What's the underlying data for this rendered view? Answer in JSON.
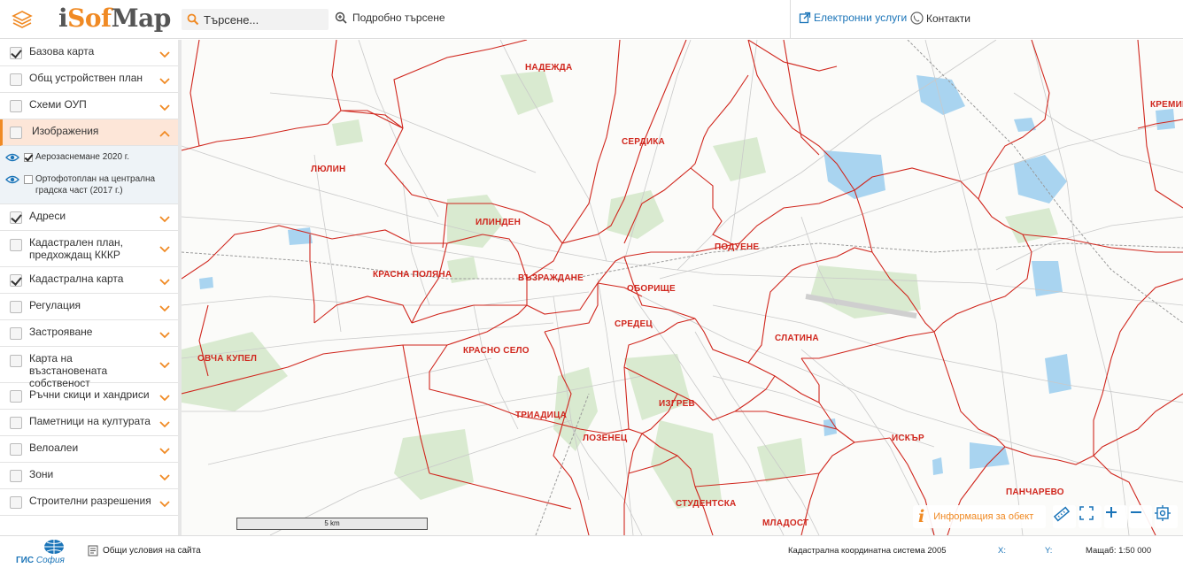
{
  "header": {
    "logo_pre": "i",
    "logo_accent": "Sof",
    "logo_post": "Map",
    "search_placeholder": "Търсене...",
    "advanced_search": "Подробно търсене",
    "eservices": "Електронни услуги",
    "contacts": "Контакти"
  },
  "sidebar": {
    "layers": [
      {
        "label": "Базова карта",
        "checked": true
      },
      {
        "label": "Общ устройствен план",
        "checked": false
      },
      {
        "label": "Схеми ОУП",
        "checked": false
      },
      {
        "label": "Изображения",
        "checked": false,
        "open": true
      },
      {
        "label": "Адреси",
        "checked": true
      },
      {
        "label": "Кадастрален план, предхождащ КККР",
        "checked": false
      },
      {
        "label": "Кадастрална карта",
        "checked": true
      },
      {
        "label": "Регулация",
        "checked": false
      },
      {
        "label": "Застрояване",
        "checked": false
      },
      {
        "label": "Карта на възстановената собственост",
        "checked": false
      },
      {
        "label": "Ръчни скици и хандриси",
        "checked": false
      },
      {
        "label": "Паметници на културата",
        "checked": false
      },
      {
        "label": "Велоалеи",
        "checked": false
      },
      {
        "label": "Зони",
        "checked": false
      },
      {
        "label": "Строителни разрешения",
        "checked": false
      }
    ],
    "sublayers": [
      {
        "label": "Аерозаснемане 2020 г.",
        "checked": true
      },
      {
        "label": "Ортофотоплан на централна градска част (2017 г.)",
        "checked": false
      }
    ]
  },
  "map": {
    "districts": {
      "nadezhda": "НАДЕЖДА",
      "kremikovtsi": "КРЕМИК",
      "serdika": "СЕРДИКА",
      "lyulin": "ЛЮЛИН",
      "ilinden": "ИЛИНДЕН",
      "poduyane": "ПОДУЕНЕ",
      "krasna_polyana": "КРАСНА ПОЛЯНА",
      "vazrazhdane": "ВЪЗРАЖДАНЕ",
      "oborishte": "ОБОРИЩЕ",
      "sredets": "СРЕДЕЦ",
      "slatina": "СЛАТИНА",
      "krasno_selo": "КРАСНО СЕЛО",
      "ovcha_kupel": "ОВЧА КУПЕЛ",
      "izgrev": "ИЗГРЕВ",
      "triaditsa": "ТРИАДИЦА",
      "lozenets": "ЛОЗЕНЕЦ",
      "iskar": "ИСКЪР",
      "pancharevo": "ПАНЧАРЕВО",
      "studentska": "СТУДЕНТСКА",
      "mladost": "МЛАДОСТ"
    },
    "scale_label": "5 km",
    "info_button": "Информация за обект",
    "colors": {
      "boundary": "#d0261d",
      "water": "#a9d4f0",
      "park": "#d9ead0",
      "accent": "#f08a24",
      "link": "#1a74b8"
    }
  },
  "footer": {
    "gis_logo_main": "ГИС",
    "gis_logo_sub": "София",
    "terms": "Общи условия на сайта",
    "coord_system": "Кадастрална координатна система 2005",
    "x_label": "X:",
    "y_label": "Y:",
    "scale": "Мащаб: 1:50 000"
  }
}
